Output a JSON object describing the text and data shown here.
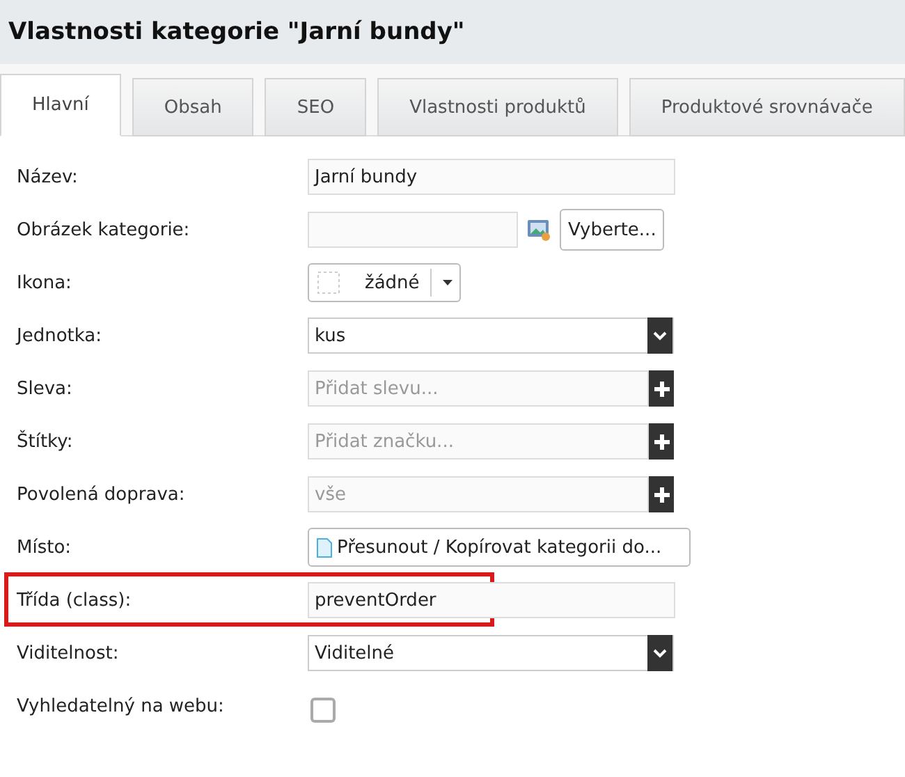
{
  "title": "Vlastnosti kategorie \"Jarní bundy\"",
  "tabs": [
    {
      "label": "Hlavní",
      "selected": true
    },
    {
      "label": "Obsah",
      "selected": false
    },
    {
      "label": "SEO",
      "selected": false
    },
    {
      "label": "Vlastnosti produktů",
      "selected": false
    },
    {
      "label": "Produktové srovnávače",
      "selected": false
    }
  ],
  "rows": [
    {
      "kind": "text",
      "label": "Název:",
      "value": "Jarní bundy",
      "highlighted": false
    },
    {
      "kind": "file",
      "label": "Obrázek kategorie:",
      "button": "Vyberte...",
      "highlighted": false
    },
    {
      "kind": "icon",
      "label": "Ikona:",
      "value": "žádné",
      "highlighted": false
    },
    {
      "kind": "select",
      "label": "Jednotka:",
      "value": "kus",
      "highlighted": false
    },
    {
      "kind": "add",
      "label": "Sleva:",
      "placeholder": "Přidat slevu...",
      "highlighted": false
    },
    {
      "kind": "add",
      "label": "Štítky:",
      "placeholder": "Přidat značku...",
      "highlighted": false
    },
    {
      "kind": "add",
      "label": "Povolená doprava:",
      "placeholder": "vše",
      "highlighted": false
    },
    {
      "kind": "place",
      "label": "Místo:",
      "button": "Přesunout / Kopírovat kategorii do...",
      "highlighted": false
    },
    {
      "kind": "text",
      "label": "Třída (class):",
      "value": "preventOrder",
      "highlighted": true
    },
    {
      "kind": "select",
      "label": "Viditelnost:",
      "value": "Viditelné",
      "highlighted": false
    },
    {
      "kind": "checkbox",
      "label": "Vyhledatelný na webu:",
      "checked": false,
      "highlighted": false
    }
  ]
}
